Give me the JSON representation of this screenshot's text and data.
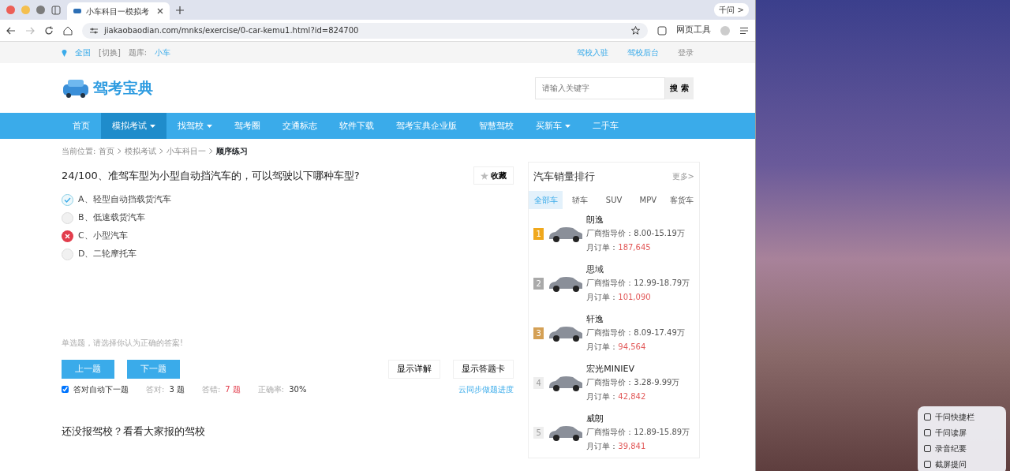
{
  "browser": {
    "tab_title": "小车科目一模拟考",
    "url": "jiakaobaodian.com/mnks/exercise/0-car-kemu1.html?id=824700",
    "assistant_label": "千问 >",
    "tools_label": "网页工具"
  },
  "topbar": {
    "location": "全国",
    "switch": "[切换]",
    "bank_label": "题库:",
    "bank": "小车",
    "links": [
      "驾校入驻",
      "驾校后台",
      "登录"
    ]
  },
  "header": {
    "logo_text": "驾考宝典",
    "search_placeholder": "请输入关键字",
    "search_button": "搜 索"
  },
  "nav": [
    {
      "label": "首页",
      "dropdown": false,
      "selected": false
    },
    {
      "label": "模拟考试",
      "dropdown": true,
      "selected": true
    },
    {
      "label": "找驾校",
      "dropdown": true,
      "selected": false
    },
    {
      "label": "驾考圈",
      "dropdown": false,
      "selected": false
    },
    {
      "label": "交通标志",
      "dropdown": false,
      "selected": false
    },
    {
      "label": "软件下载",
      "dropdown": false,
      "selected": false
    },
    {
      "label": "驾考宝典企业版",
      "dropdown": false,
      "selected": false
    },
    {
      "label": "智慧驾校",
      "dropdown": false,
      "selected": false
    },
    {
      "label": "买新车",
      "dropdown": true,
      "selected": false
    },
    {
      "label": "二手车",
      "dropdown": false,
      "selected": false
    }
  ],
  "breadcrumb": {
    "prefix": "当前位置:",
    "items": [
      "首页",
      "模拟考试",
      "小车科目一"
    ],
    "current": "顺序练习"
  },
  "question": {
    "title": "24/100、准驾车型为小型自动挡汽车的，可以驾驶以下哪种车型?",
    "favorite": "收藏",
    "options": [
      {
        "label": "A、轻型自动挡载货汽车",
        "correct": true,
        "chosen": false
      },
      {
        "label": "B、低速载货汽车",
        "correct": false,
        "chosen": false
      },
      {
        "label": "C、小型汽车",
        "correct": false,
        "chosen": true
      },
      {
        "label": "D、二轮摩托车",
        "correct": false,
        "chosen": false
      }
    ],
    "hint": "单选题，请选择你认为正确的答案!",
    "prev": "上一题",
    "next": "下一题",
    "detail": "显示详解",
    "card": "显示答题卡",
    "auto_next": {
      "label": "答对自动下一题",
      "checked": true
    },
    "stats": [
      {
        "label": "答对:",
        "value": "3 题",
        "kind": "plain"
      },
      {
        "label": "答错:",
        "value": "7 题",
        "kind": "wrong"
      },
      {
        "label": "正确率:",
        "value": "30%",
        "kind": "plain"
      }
    ],
    "sync_link": "云同步做题进度"
  },
  "schools_title": "还没报驾校？看看大家报的驾校",
  "ranking": {
    "title": "汽车销量排行",
    "more": "更多>",
    "tabs": [
      {
        "label": "全部车",
        "selected": true
      },
      {
        "label": "轿车",
        "selected": false
      },
      {
        "label": "SUV",
        "selected": false
      },
      {
        "label": "MPV",
        "selected": false
      },
      {
        "label": "客货车",
        "selected": false
      }
    ],
    "cars": [
      {
        "rank": "1",
        "color": "#f0a81c",
        "name": "朗逸",
        "price": "厂商指导价：8.00-15.19万",
        "orders_label": "月订单：",
        "orders": "187,645"
      },
      {
        "rank": "2",
        "color": "#a9a9a9",
        "name": "思域",
        "price": "厂商指导价：12.99-18.79万",
        "orders_label": "月订单：",
        "orders": "101,090"
      },
      {
        "rank": "3",
        "color": "#d4a055",
        "name": "轩逸",
        "price": "厂商指导价：8.09-17.49万",
        "orders_label": "月订单：",
        "orders": "94,564"
      },
      {
        "rank": "4",
        "color": "#eeeeee",
        "name": "宏光MINIEV",
        "price": "厂商指导价：3.28-9.99万",
        "orders_label": "月订单：",
        "orders": "42,842"
      },
      {
        "rank": "5",
        "color": "#eeeeee",
        "name": "威朗",
        "price": "厂商指导价：12.89-15.89万",
        "orders_label": "月订单：",
        "orders": "39,841"
      }
    ]
  },
  "desktop_menu": [
    "千问快捷栏",
    "千问读屏",
    "录音纪要",
    "截屏提问"
  ]
}
